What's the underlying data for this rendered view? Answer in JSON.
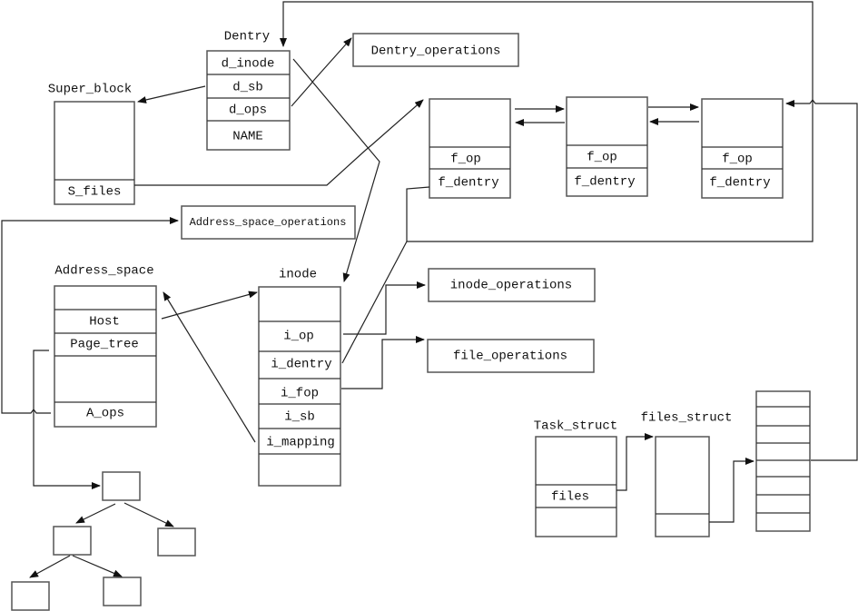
{
  "dentry": {
    "title": "Dentry",
    "fields": [
      "d_inode",
      "d_sb",
      "d_ops",
      "NAME"
    ]
  },
  "super_block": {
    "title": "Super_block",
    "fields": [
      "S_files"
    ]
  },
  "dentry_operations": "Dentry_operations",
  "address_space_operations": "Address_space_operations",
  "files": [
    {
      "fields": [
        "f_op",
        "f_dentry"
      ]
    },
    {
      "fields": [
        "f_op",
        "f_dentry"
      ]
    },
    {
      "fields": [
        "f_op",
        "f_dentry"
      ]
    }
  ],
  "address_space": {
    "title": "Address_space",
    "fields": [
      "Host",
      "Page_tree",
      "A_ops"
    ]
  },
  "inode": {
    "title": "inode",
    "fields": [
      "i_op",
      "i_dentry",
      "i_fop",
      "i_sb",
      "i_mapping"
    ]
  },
  "inode_operations": "inode_operations",
  "file_operations": "file_operations",
  "task_struct": {
    "title": "Task_struct",
    "fields": [
      "files"
    ]
  },
  "files_struct": {
    "title": "files_struct"
  }
}
